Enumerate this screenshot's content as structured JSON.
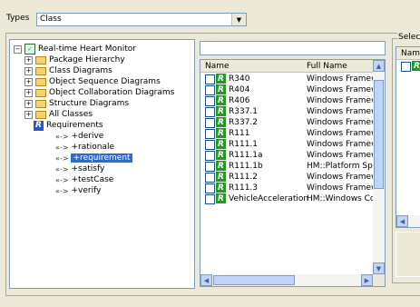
{
  "types": {
    "label": "Types",
    "value": "Class"
  },
  "tree": {
    "root": "Real-time Heart Monitor",
    "folders": [
      "Package Hierarchy",
      "Class Diagrams",
      "Object Sequence Diagrams",
      "Object Collaboration Diagrams",
      "Structure Diagrams",
      "All Classes"
    ],
    "requirements": "Requirements",
    "relations": [
      "+derive",
      "+rationale",
      "+requirement",
      "+satisfy",
      "+testCase",
      "+verify"
    ],
    "arrow_glyph": "«->",
    "selected": "+requirement"
  },
  "search": {
    "value": ""
  },
  "list": {
    "columns": [
      "Name",
      "Full Name"
    ],
    "rows": [
      {
        "name": "R340",
        "full": "Windows Framewo"
      },
      {
        "name": "R404",
        "full": "Windows Framewo"
      },
      {
        "name": "R406",
        "full": "Windows Framewo"
      },
      {
        "name": "R337.1",
        "full": "Windows Framewo"
      },
      {
        "name": "R337.2",
        "full": "Windows Framewo"
      },
      {
        "name": "R111",
        "full": "Windows Framewo"
      },
      {
        "name": "R111.1",
        "full": "Windows Framewo"
      },
      {
        "name": "R111.1a",
        "full": "Windows Framewo"
      },
      {
        "name": "R111.1b",
        "full": "HM::Platform Spec"
      },
      {
        "name": "R111.2",
        "full": "Windows Framewo"
      },
      {
        "name": "R111.3",
        "full": "Windows Framewo"
      },
      {
        "name": "VehicleAcceleration",
        "full": "HM::Windows Com"
      }
    ],
    "icon_letter": "R"
  },
  "right": {
    "group_label": "Select",
    "column": "Name"
  },
  "colors": {
    "selection": "#316ac5",
    "req_icon_green": "#1f9b1f",
    "req_icon_blue": "#2a55c8",
    "folder": "#f4d36c"
  }
}
